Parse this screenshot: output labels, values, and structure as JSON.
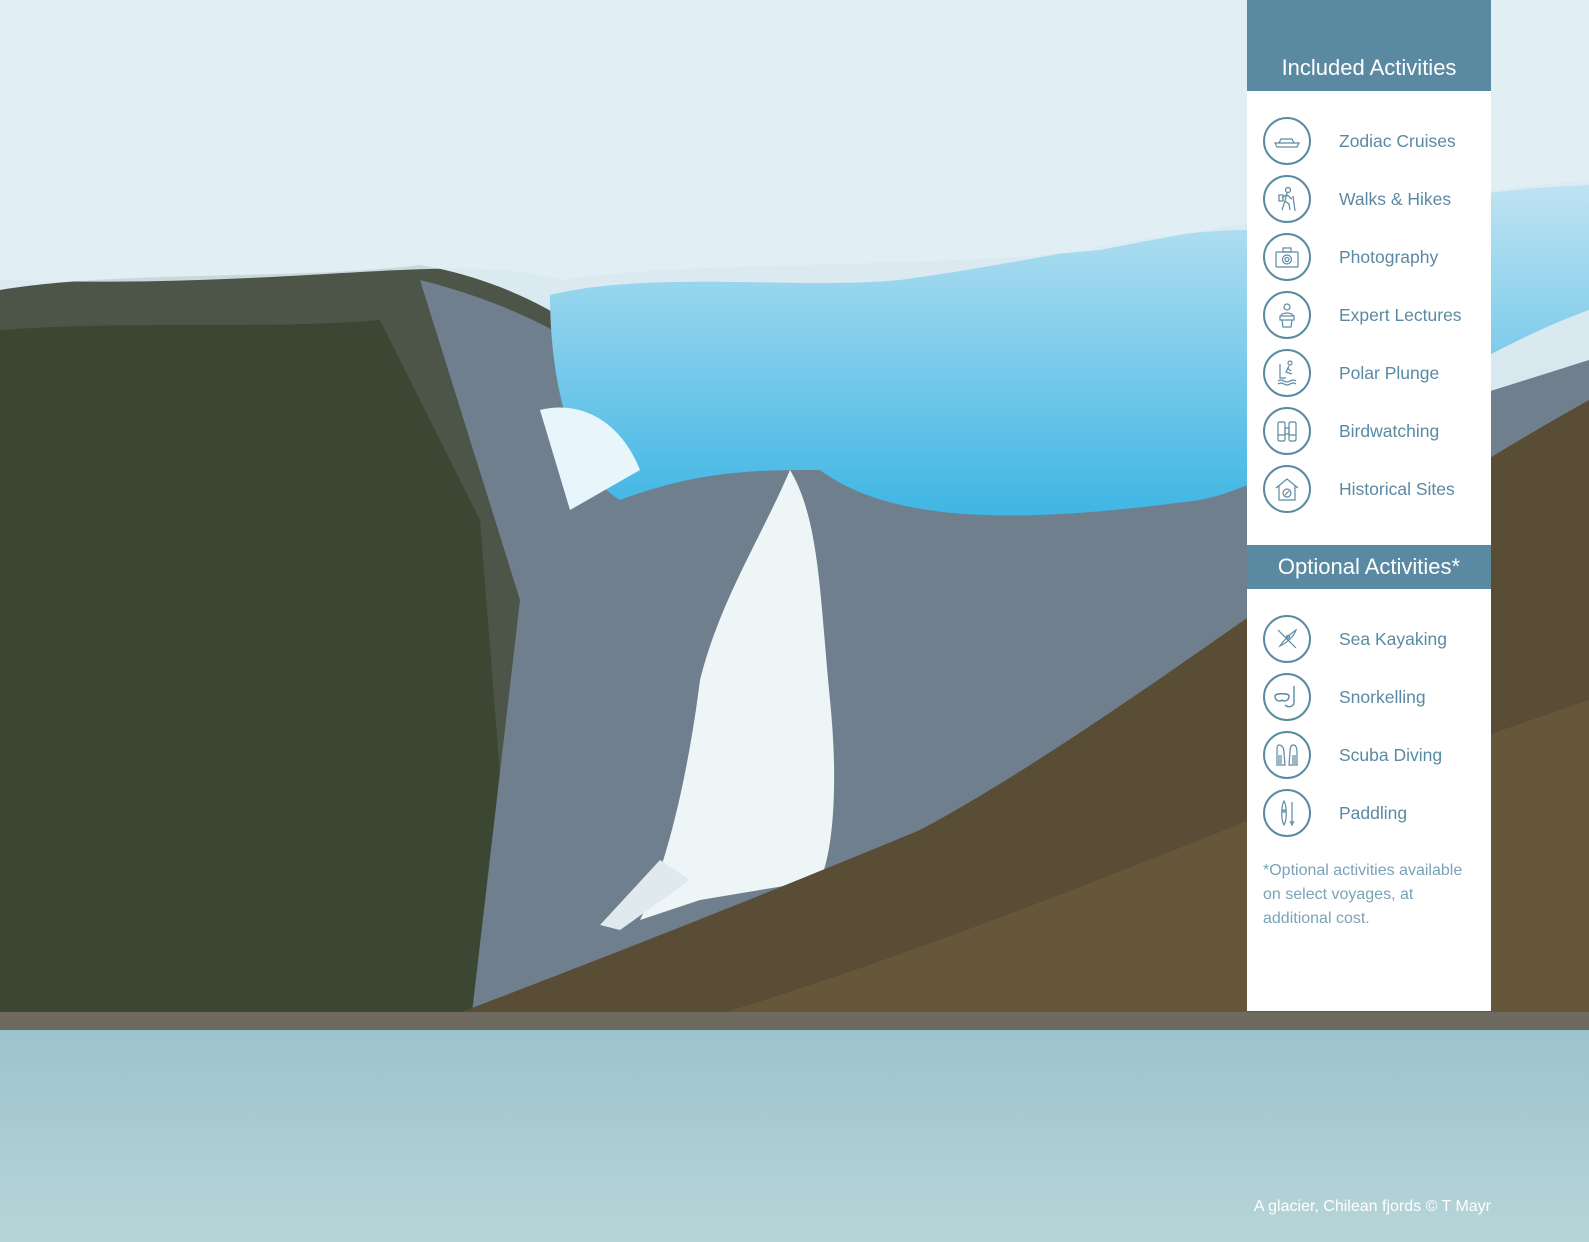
{
  "colors": {
    "panel_header": "#5a8aa2",
    "label_text": "#5a8aa2",
    "note_text": "#7aa3b8",
    "panel_bg": "#ffffff"
  },
  "panel": {
    "included": {
      "title": "Included Activities",
      "items": [
        {
          "label": "Zodiac Cruises",
          "icon": "zodiac-boat-icon"
        },
        {
          "label": "Walks & Hikes",
          "icon": "hiker-icon"
        },
        {
          "label": "Photography",
          "icon": "camera-icon"
        },
        {
          "label": "Expert Lectures",
          "icon": "lecturer-icon"
        },
        {
          "label": "Polar Plunge",
          "icon": "plunge-icon"
        },
        {
          "label": "Birdwatching",
          "icon": "binoculars-icon"
        },
        {
          "label": "Historical Sites",
          "icon": "historic-house-icon"
        }
      ]
    },
    "optional": {
      "title": "Optional Activities*",
      "items": [
        {
          "label": "Sea Kayaking",
          "icon": "kayak-icon"
        },
        {
          "label": "Snorkelling",
          "icon": "snorkel-mask-icon"
        },
        {
          "label": "Scuba Diving",
          "icon": "fins-icon"
        },
        {
          "label": "Paddling",
          "icon": "paddle-board-icon"
        }
      ]
    },
    "note": "*Optional activities available on select voyages, at additional cost."
  },
  "caption": "A glacier, Chilean fjords © T Mayr"
}
